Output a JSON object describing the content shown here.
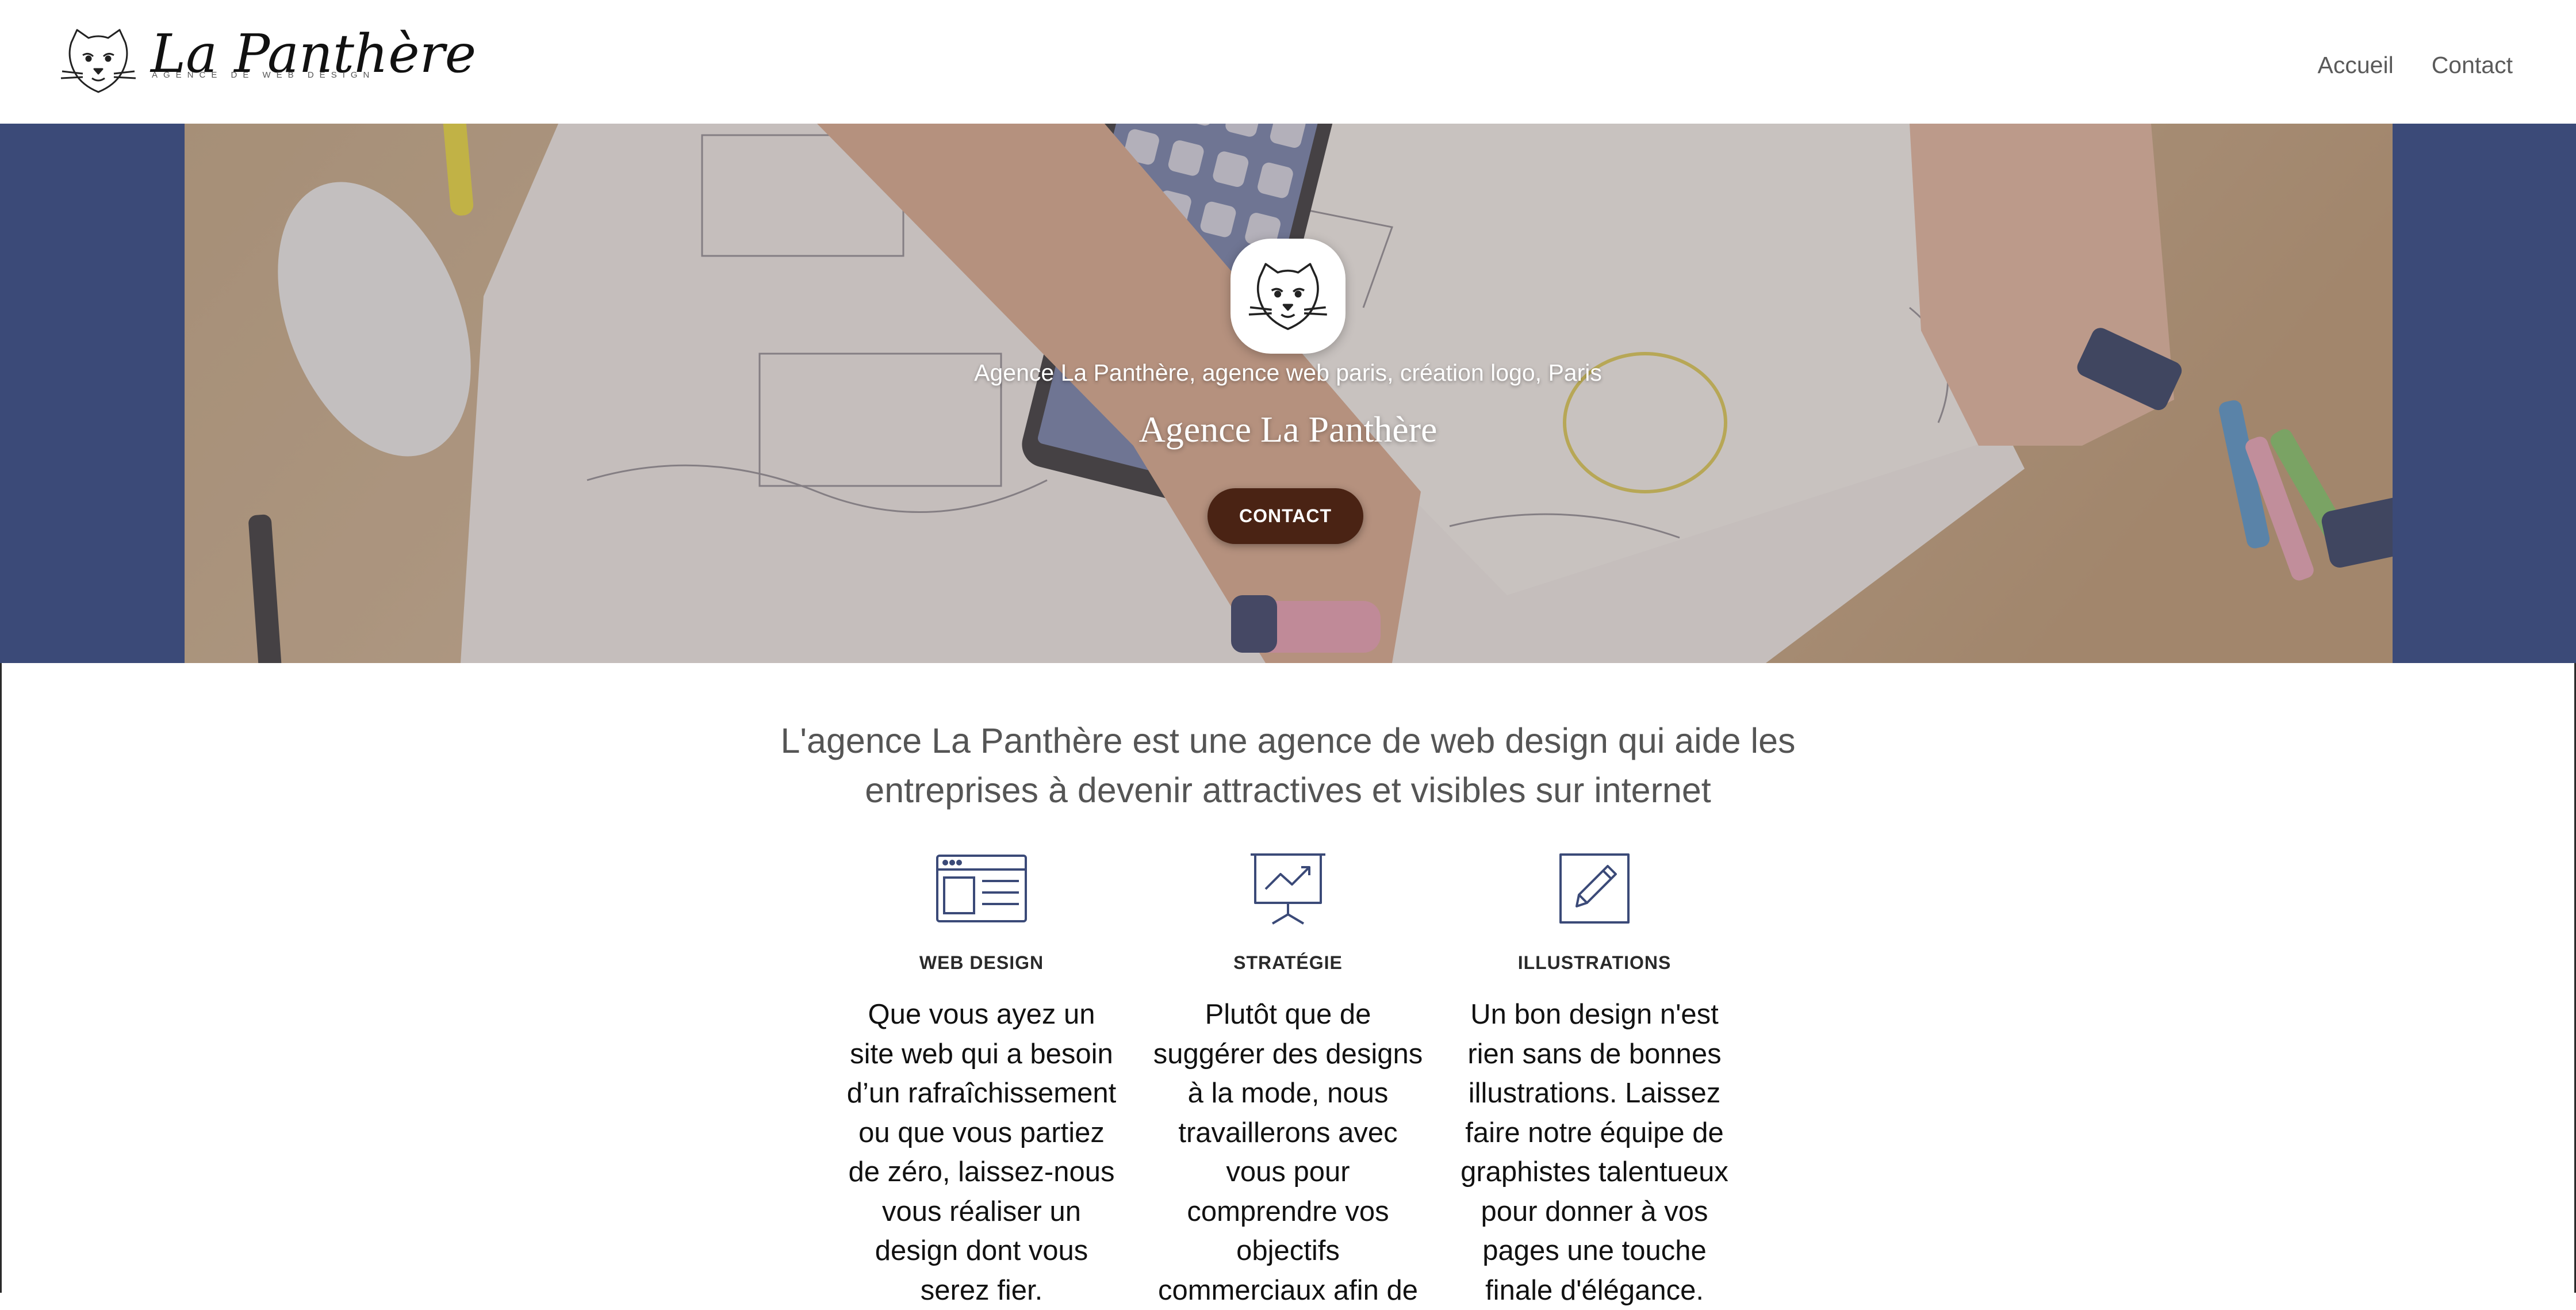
{
  "header": {
    "logo_title": "La Panthère",
    "logo_subtitle": "AGENCE DE WEB DESIGN",
    "logo_icon": "panther-head-icon",
    "nav": [
      {
        "label": "Accueil"
      },
      {
        "label": "Contact"
      }
    ]
  },
  "hero": {
    "badge_icon": "panther-head-icon",
    "tagline": "Agence La Panthère, agence web paris, création logo, Paris",
    "title": "Agence La Panthère",
    "cta_label": "CONTACT",
    "side_color": "#3b4a78",
    "cta_color": "#4a2314"
  },
  "intro": {
    "text": "L'agence La Panthère est une agence de web design qui aide les entreprises à devenir attractives et visibles sur internet"
  },
  "services": [
    {
      "icon": "browser-window-icon",
      "title": "WEB DESIGN",
      "text": "Que vous ayez un site web qui a besoin d’un rafraîchissement ou que vous partiez de zéro, laissez-nous vous réaliser un design dont vous serez fier."
    },
    {
      "icon": "presentation-chart-icon",
      "title": "STRATÉGIE",
      "text": "Plutôt que de suggérer des designs à la mode, nous travaillerons avec vous pour comprendre vos objectifs commerciaux afin de"
    },
    {
      "icon": "pencil-square-icon",
      "title": "ILLUSTRATIONS",
      "text": "Un bon design n'est rien sans de bonnes illustrations. Laissez faire notre équipe de graphistes talentueux pour donner à vos pages une touche finale d'élégance."
    }
  ],
  "colors": {
    "icon_navy": "#3b4a78",
    "text_gray": "#555555"
  }
}
